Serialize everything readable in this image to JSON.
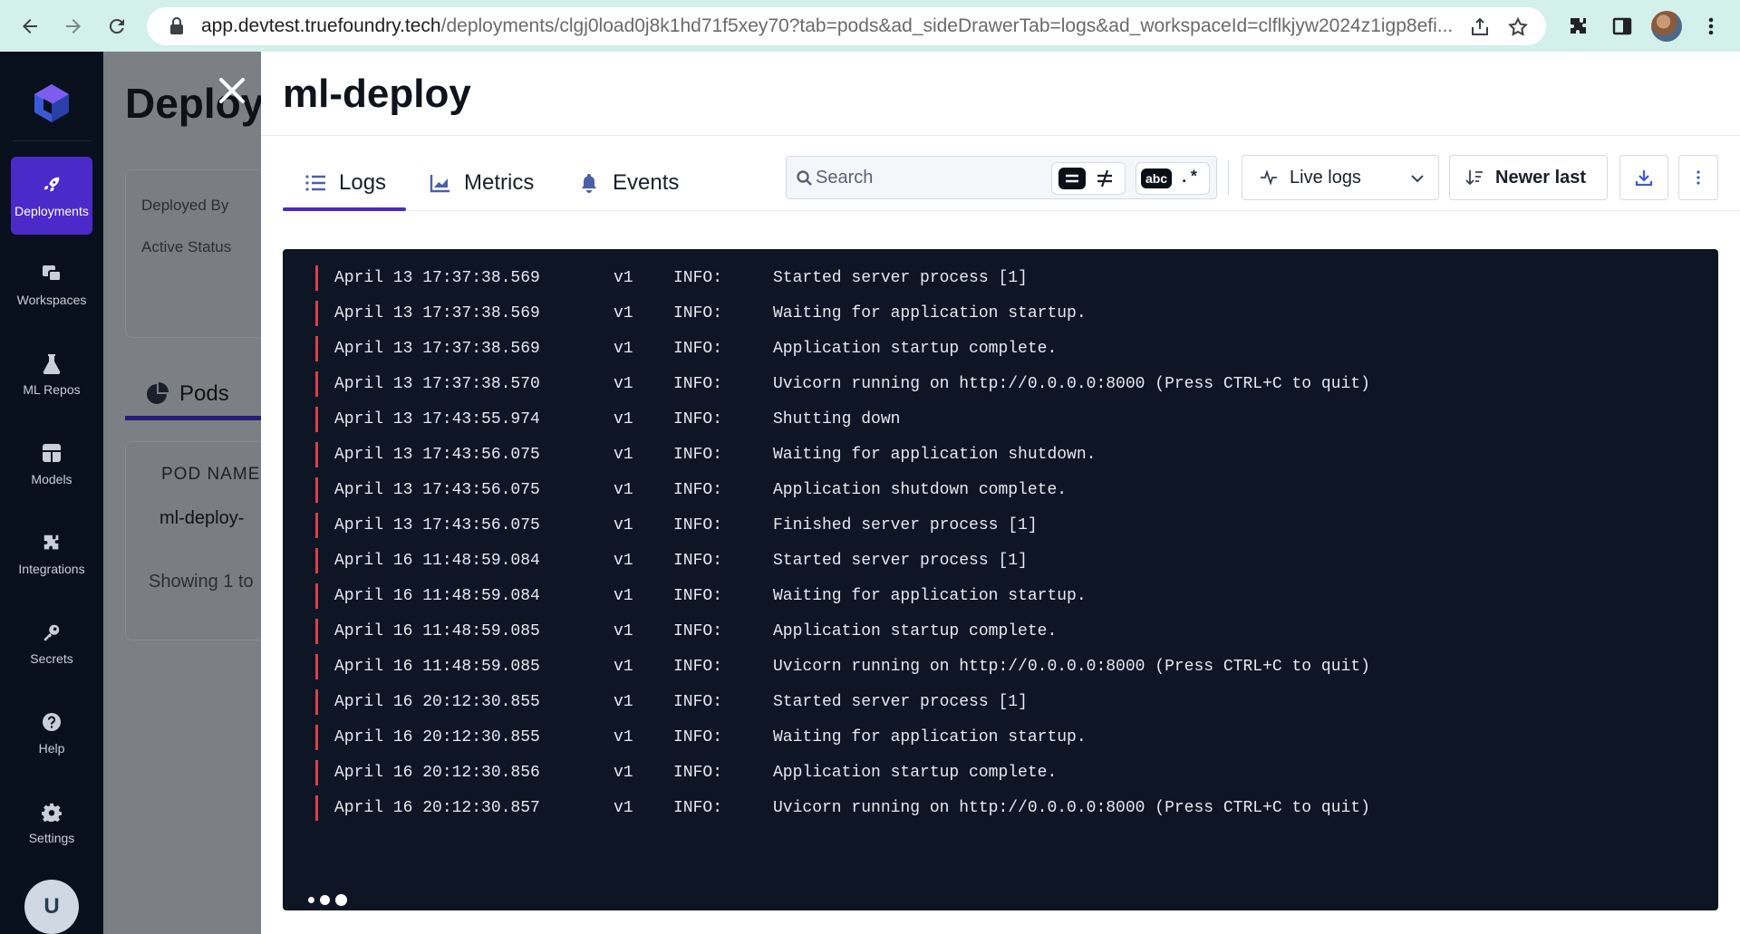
{
  "browser": {
    "url_host": "app.devtest.truefoundry.tech",
    "url_path": "/deployments/clgj0load0j8k1hd71f5xey70?tab=pods&ad_sideDrawerTab=logs&ad_workspaceId=clflkjyw2024z1igp8efi..."
  },
  "sidebar": {
    "items": [
      {
        "label": "Deployments",
        "icon": "rocket-icon",
        "active": true
      },
      {
        "label": "Workspaces",
        "icon": "workspaces-icon",
        "active": false
      },
      {
        "label": "ML Repos",
        "icon": "flask-icon",
        "active": false
      },
      {
        "label": "Models",
        "icon": "grid-icon",
        "active": false
      },
      {
        "label": "Integrations",
        "icon": "puzzle-icon",
        "active": false
      },
      {
        "label": "Secrets",
        "icon": "key-icon",
        "active": false
      },
      {
        "label": "Help",
        "icon": "help-icon",
        "active": false
      },
      {
        "label": "Settings",
        "icon": "gear-icon",
        "active": false
      }
    ],
    "user_initial": "U"
  },
  "background_page": {
    "title": "Deploy",
    "deployed_by_label": "Deployed By",
    "active_status_label": "Active Status",
    "pods_tab": "Pods",
    "table_header": "POD NAME",
    "pod_name": "ml-deploy-",
    "showing": "Showing 1 to"
  },
  "drawer": {
    "title": "ml-deploy",
    "tabs": [
      {
        "label": "Logs",
        "icon": "list-icon",
        "active": true
      },
      {
        "label": "Metrics",
        "icon": "chart-icon",
        "active": false
      },
      {
        "label": "Events",
        "icon": "bell-icon",
        "active": false
      }
    ],
    "search": {
      "placeholder": "Search",
      "value": ""
    },
    "filter_toggles": {
      "regex_label": ".*",
      "case_label": "abc"
    },
    "live_logs": {
      "selected": "Live logs"
    },
    "sort": {
      "label": "Newer last"
    }
  },
  "logs": [
    {
      "ts": "April 13 17:37:38.569",
      "ver": "v1",
      "level": "INFO:",
      "msg": "Started server process [1]"
    },
    {
      "ts": "April 13 17:37:38.569",
      "ver": "v1",
      "level": "INFO:",
      "msg": "Waiting for application startup."
    },
    {
      "ts": "April 13 17:37:38.569",
      "ver": "v1",
      "level": "INFO:",
      "msg": "Application startup complete."
    },
    {
      "ts": "April 13 17:37:38.570",
      "ver": "v1",
      "level": "INFO:",
      "msg": "Uvicorn running on http://0.0.0.0:8000 (Press CTRL+C to quit)"
    },
    {
      "ts": "April 13 17:43:55.974",
      "ver": "v1",
      "level": "INFO:",
      "msg": "Shutting down"
    },
    {
      "ts": "April 13 17:43:56.075",
      "ver": "v1",
      "level": "INFO:",
      "msg": "Waiting for application shutdown."
    },
    {
      "ts": "April 13 17:43:56.075",
      "ver": "v1",
      "level": "INFO:",
      "msg": "Application shutdown complete."
    },
    {
      "ts": "April 13 17:43:56.075",
      "ver": "v1",
      "level": "INFO:",
      "msg": "Finished server process [1]"
    },
    {
      "ts": "April 16 11:48:59.084",
      "ver": "v1",
      "level": "INFO:",
      "msg": "Started server process [1]"
    },
    {
      "ts": "April 16 11:48:59.084",
      "ver": "v1",
      "level": "INFO:",
      "msg": "Waiting for application startup."
    },
    {
      "ts": "April 16 11:48:59.085",
      "ver": "v1",
      "level": "INFO:",
      "msg": "Application startup complete."
    },
    {
      "ts": "April 16 11:48:59.085",
      "ver": "v1",
      "level": "INFO:",
      "msg": "Uvicorn running on http://0.0.0.0:8000 (Press CTRL+C to quit)"
    },
    {
      "ts": "April 16 20:12:30.855",
      "ver": "v1",
      "level": "INFO:",
      "msg": "Started server process [1]"
    },
    {
      "ts": "April 16 20:12:30.855",
      "ver": "v1",
      "level": "INFO:",
      "msg": "Waiting for application startup."
    },
    {
      "ts": "April 16 20:12:30.856",
      "ver": "v1",
      "level": "INFO:",
      "msg": "Application startup complete."
    },
    {
      "ts": "April 16 20:12:30.857",
      "ver": "v1",
      "level": "INFO:",
      "msg": "Uvicorn running on http://0.0.0.0:8000 (Press CTRL+C to quit)"
    }
  ],
  "colors": {
    "accent": "#4b2ac9",
    "sidebar_bg": "#08101d",
    "log_bg": "#0e1524",
    "log_bar": "#d8414a"
  }
}
